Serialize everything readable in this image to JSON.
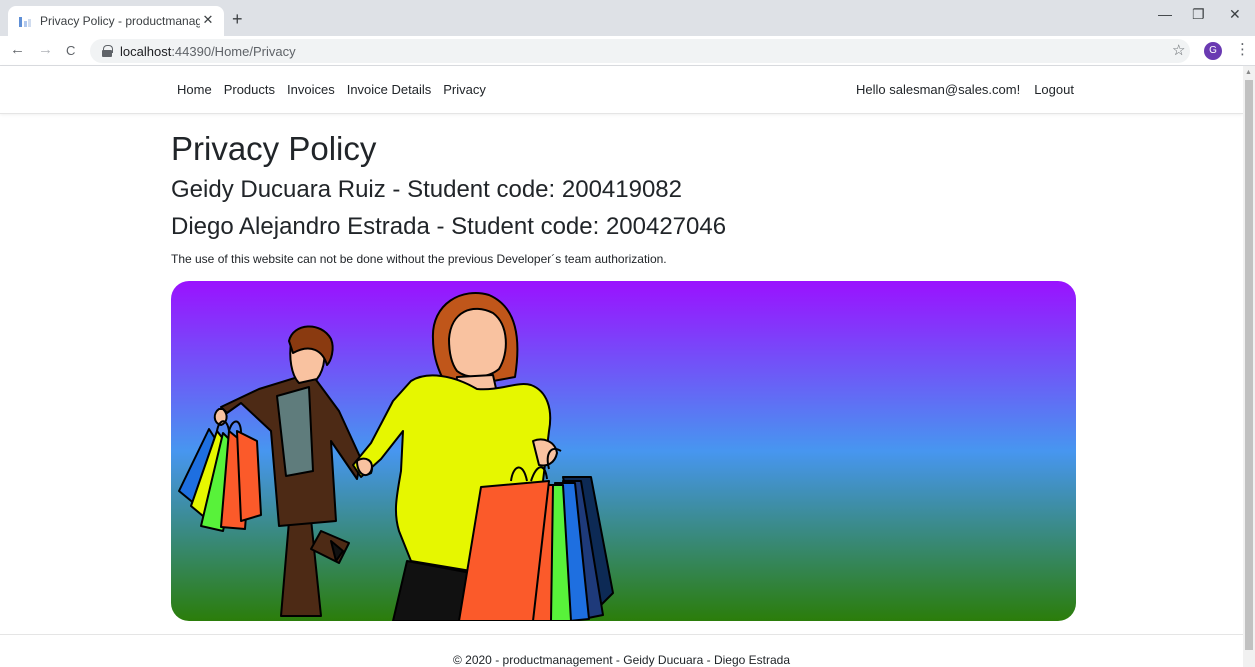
{
  "browser": {
    "tab_title": "Privacy Policy - productmanagem",
    "tab_close": "✕",
    "new_tab": "+",
    "url_host": "localhost",
    "url_path": ":44390/Home/Privacy",
    "profile_initial": "G",
    "icons": {
      "back": "←",
      "forward": "→",
      "reload": "C",
      "bookmark": "☆",
      "menu": "⋮",
      "minimize": "—",
      "restore": "❐",
      "close": "✕"
    }
  },
  "navbar": {
    "links": [
      "Home",
      "Products",
      "Invoices",
      "Invoice Details",
      "Privacy"
    ],
    "greeting": "Hello salesman@sales.com!",
    "logout": "Logout"
  },
  "content": {
    "title": "Privacy Policy",
    "student1": "Geidy Ducuara Ruiz - Student code: 200419082",
    "student2": "Diego Alejandro Estrada - Student code: 200427046",
    "notice": "The use of this website can not be done without the previous Developer´s team authorization."
  },
  "footer": {
    "text": "© 2020 - productmanagement - Geidy Ducuara - Diego Estrada"
  },
  "colors": {
    "gradient_top": "#9a12ff",
    "gradient_mid": "#4796f0",
    "gradient_bottom": "#2b7d0a",
    "shirt_yellow": "#e6f700",
    "bag_orange": "#fb5a2a",
    "bag_green": "#58f23a",
    "bag_blue": "#1e6fe0",
    "bag_navy": "#0d2a55"
  }
}
